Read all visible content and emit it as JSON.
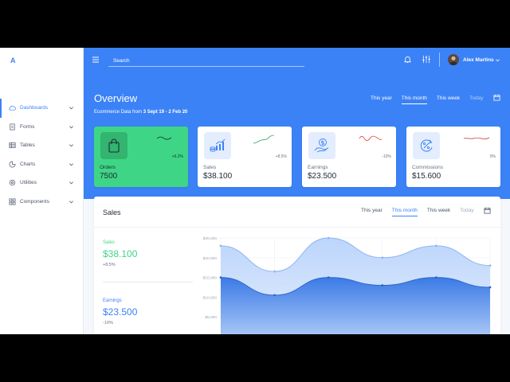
{
  "brand": {
    "logo": "A"
  },
  "sidebar": {
    "items": [
      {
        "label": "Dashboards",
        "icon": "cloud-icon",
        "active": true
      },
      {
        "label": "Forms",
        "icon": "document-icon",
        "active": false
      },
      {
        "label": "Tables",
        "icon": "table-icon",
        "active": false
      },
      {
        "label": "Charts",
        "icon": "chart-icon",
        "active": false
      },
      {
        "label": "Utilities",
        "icon": "settings-icon",
        "active": false
      },
      {
        "label": "Components",
        "icon": "grid-icon",
        "active": false
      }
    ]
  },
  "header": {
    "search_placeholder": "Search",
    "user_name": "Alex Martins",
    "title": "Overview",
    "subtitle_prefix": "Ecommerce Data from",
    "date_range": "3 Sept 19 - 2 Feb 20",
    "tabs": [
      "This year",
      "This month",
      "This week",
      "Today"
    ],
    "active_tab": 1
  },
  "colors": {
    "primary": "#3b82f6",
    "green": "#3ed686",
    "red": "#e53e3e",
    "spark_green": "#38a169"
  },
  "cards": [
    {
      "label": "Orders",
      "value": "7500",
      "change": "+6.2%",
      "icon": "shopping-bag-icon"
    },
    {
      "label": "Sales",
      "value": "$38.100",
      "change": "+8.5%",
      "icon": "coins-growth-icon"
    },
    {
      "label": "Earnings",
      "value": "$23.500",
      "change": "-10%",
      "icon": "hand-dollar-icon"
    },
    {
      "label": "Commissions",
      "value": "$15.600",
      "change": "0%",
      "icon": "percent-cycle-icon"
    }
  ],
  "sales_panel": {
    "title": "Sales",
    "tabs": [
      "This year",
      "This month",
      "This week",
      "Today"
    ],
    "active_tab": 1,
    "sales": {
      "label": "Sales",
      "value": "$38.100",
      "change": "+8.5%"
    },
    "earnings": {
      "label": "Earnings",
      "value": "$23.500",
      "change": "-10%"
    }
  },
  "chart_data": {
    "type": "area",
    "y_ticks": [
      "$25,000",
      "$20,000",
      "$15,000",
      "$10,000",
      "$5,000",
      "$0"
    ],
    "ylim": [
      0,
      25000
    ],
    "grid": true,
    "series": [
      {
        "values": [
          23000,
          16500,
          25000,
          20000,
          23000,
          18000
        ]
      },
      {
        "values": [
          15000,
          10500,
          15000,
          13000,
          15000,
          12500
        ]
      }
    ]
  }
}
